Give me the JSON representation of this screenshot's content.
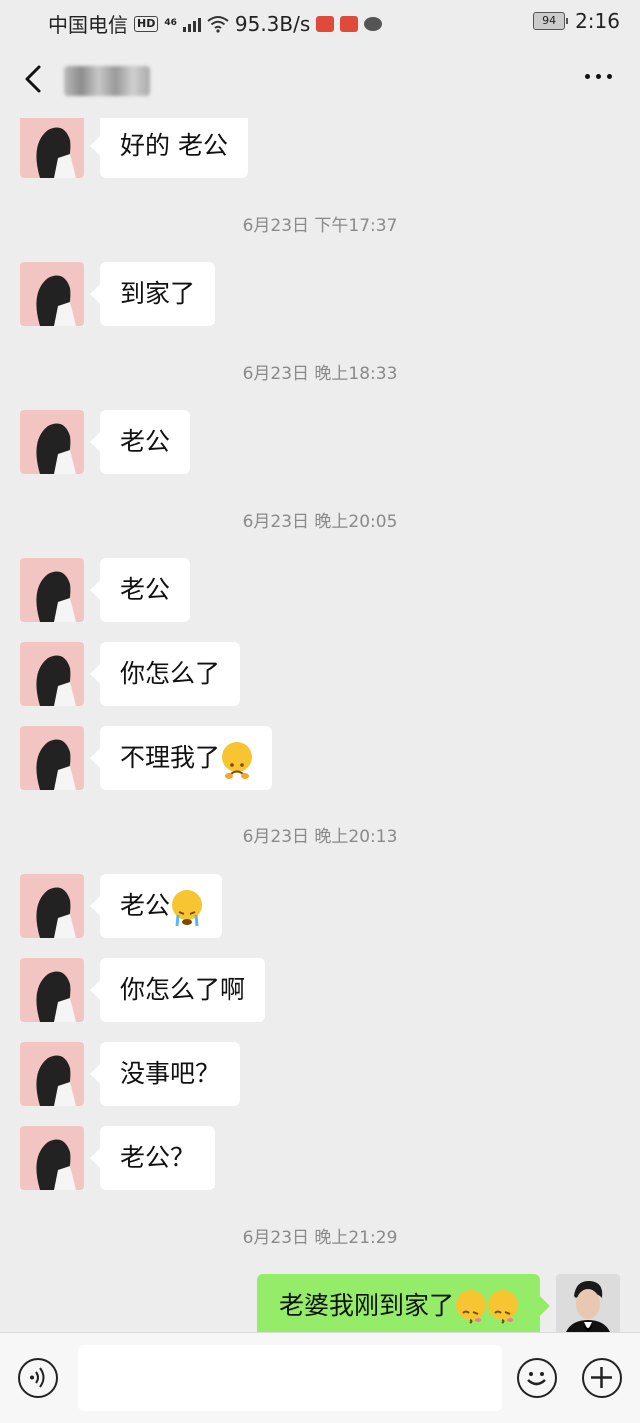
{
  "status_bar": {
    "carrier": "中国电信",
    "hd": "HD",
    "network": "46",
    "speed": "95.3B/s",
    "battery": "94",
    "time": "2:16"
  },
  "header": {
    "contact_name": "",
    "back_icon": "chevron-left-icon",
    "more_icon": "more-dots-icon"
  },
  "colors": {
    "background": "#ededed",
    "incoming_bubble": "#ffffff",
    "outgoing_bubble": "#95ec69"
  },
  "messages": [
    {
      "type": "incoming",
      "text": "好的 老公"
    },
    {
      "type": "timestamp",
      "text": "6月23日 下午17:37"
    },
    {
      "type": "incoming",
      "text": "到家了"
    },
    {
      "type": "timestamp",
      "text": "6月23日 晚上18:33"
    },
    {
      "type": "incoming",
      "text": "老公"
    },
    {
      "type": "timestamp",
      "text": "6月23日 晚上20:05"
    },
    {
      "type": "incoming",
      "text": "老公"
    },
    {
      "type": "incoming",
      "text": "你怎么了"
    },
    {
      "type": "incoming",
      "text": "不理我了",
      "emoji": "sad-face-emoji"
    },
    {
      "type": "timestamp",
      "text": "6月23日 晚上20:13"
    },
    {
      "type": "incoming",
      "text": "老公",
      "emoji": "crying-face-emoji"
    },
    {
      "type": "incoming",
      "text": "你怎么了啊"
    },
    {
      "type": "incoming",
      "text": "没事吧？"
    },
    {
      "type": "incoming",
      "text": "老公？"
    },
    {
      "type": "timestamp",
      "text": "6月23日 晚上21:29"
    },
    {
      "type": "outgoing",
      "text": "老婆我刚到家了",
      "emojis": [
        "kissing-face-emoji",
        "kissing-face-emoji"
      ]
    }
  ],
  "input_bar": {
    "voice_icon": "voice-icon",
    "input_value": "",
    "emoji_icon": "smiley-icon",
    "plus_icon": "plus-icon"
  }
}
